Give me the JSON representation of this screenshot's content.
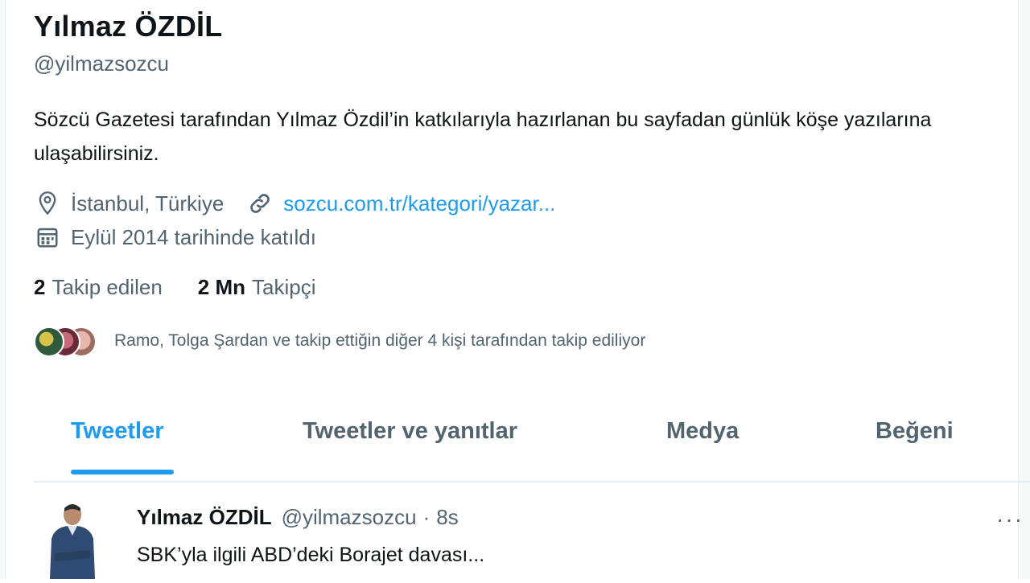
{
  "profile": {
    "name": "Yılmaz ÖZDİL",
    "handle": "@yilmazsozcu",
    "bio": "Sözcü Gazetesi tarafından Yılmaz Özdil’in katkılarıyla hazırlanan bu sayfadan günlük köşe yazılarına ulaşabilirsiniz.",
    "location": "İstanbul, Türkiye",
    "website": "sozcu.com.tr/kategori/yazar...",
    "joined": "Eylül 2014 tarihinde katıldı",
    "following_count": "2",
    "following_label": "Takip edilen",
    "followers_count": "2 Mn",
    "followers_label": "Takipçi",
    "followed_by_text": "Ramo, Tolga Şardan ve takip ettiğin diğer 4 kişi tarafından takip ediliyor"
  },
  "tabs": [
    {
      "label": "Tweetler",
      "active": true
    },
    {
      "label": "Tweetler ve yanıtlar",
      "active": false
    },
    {
      "label": "Medya",
      "active": false
    },
    {
      "label": "Beğeni",
      "active": false
    }
  ],
  "tweet": {
    "name": "Yılmaz ÖZDİL",
    "handle": "@yilmazsozcu",
    "separator": "·",
    "time": "8s",
    "text": "SBK’yla ilgili ABD’deki Borajet davası...",
    "more": "···"
  },
  "colors": {
    "accent": "#1d9bf0",
    "secondary_text": "#536471",
    "primary_text": "#0f1419"
  },
  "icons": [
    "location-icon",
    "link-icon",
    "calendar-icon",
    "more-icon"
  ]
}
